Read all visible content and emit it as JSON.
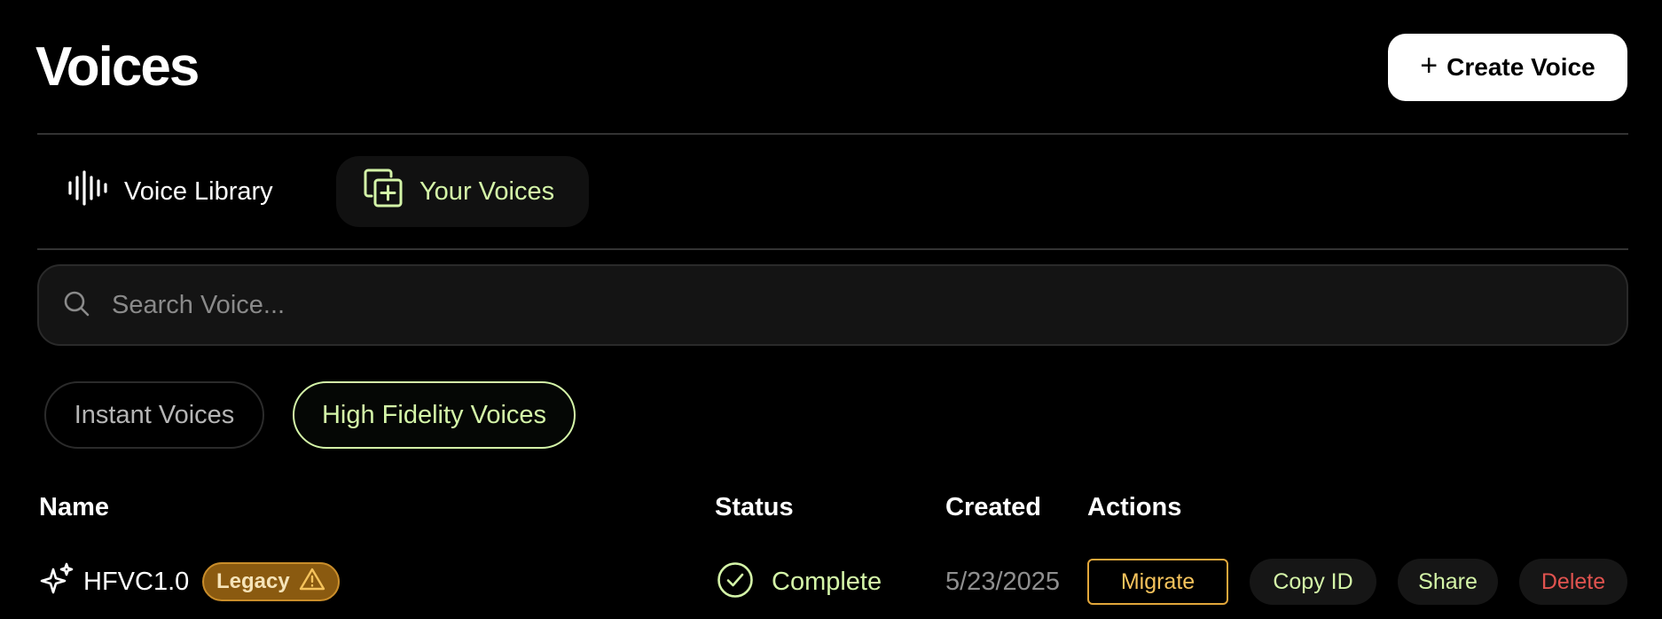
{
  "page": {
    "title": "Voices"
  },
  "header": {
    "create_label": "Create Voice"
  },
  "tabs": [
    {
      "label": "Voice Library",
      "icon": "waveform-icon",
      "active": false
    },
    {
      "label": "Your Voices",
      "icon": "copy-plus-icon",
      "active": true
    }
  ],
  "search": {
    "placeholder": "Search Voice...",
    "value": ""
  },
  "filters": [
    {
      "label": "Instant Voices",
      "active": false
    },
    {
      "label": "High Fidelity Voices",
      "active": true
    }
  ],
  "table": {
    "columns": [
      "Name",
      "Status",
      "Created",
      "Actions"
    ],
    "rows": [
      {
        "name": "HFVC1.0",
        "badge": "Legacy",
        "status": "Complete",
        "created": "5/23/2025",
        "actions": {
          "migrate": "Migrate",
          "copy_id": "Copy ID",
          "share": "Share",
          "delete": "Delete"
        }
      }
    ]
  },
  "colors": {
    "accent": "#d4f5a8",
    "warning": "#e2a73b",
    "danger": "#e0534f",
    "background": "#000000"
  }
}
